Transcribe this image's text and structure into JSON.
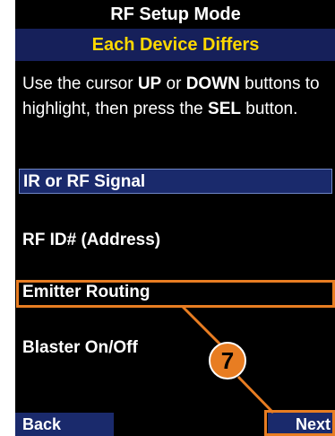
{
  "header": {
    "title": "RF Setup Mode",
    "subtitle": "Each Device Differs"
  },
  "instructions": {
    "part1": "Use the cursor ",
    "up": "UP",
    "or": " or ",
    "down": "DOWN",
    "part2": " buttons to highlight, then press the ",
    "sel": "SEL",
    "part3": " button."
  },
  "menu": {
    "items": [
      {
        "label": "IR or RF Signal",
        "selected": true
      },
      {
        "label": "RF ID# (Address)",
        "selected": false
      },
      {
        "label": "Emitter Routing",
        "selected": false
      },
      {
        "label": "Blaster On/Off",
        "selected": false
      }
    ]
  },
  "softkeys": {
    "back_label": "Back",
    "next_label": "Next"
  },
  "callout": {
    "number": "7",
    "color": "#e87d22"
  },
  "colors": {
    "subtitle_text": "#ffd800",
    "highlight": "#1a2a6c",
    "background": "#000000"
  }
}
